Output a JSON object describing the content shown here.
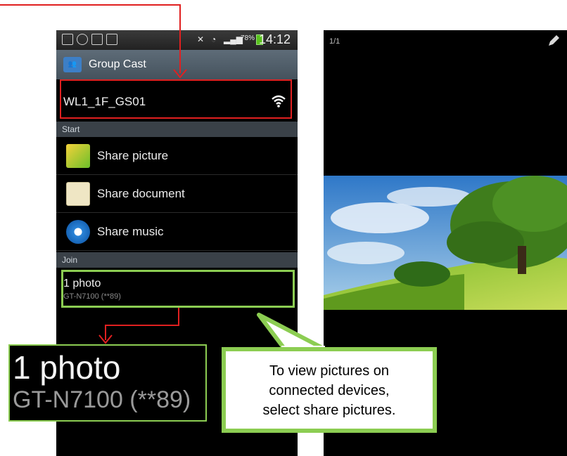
{
  "status_bar": {
    "battery": "78%",
    "time": "14:12"
  },
  "app": {
    "title": "Group Cast",
    "icon": "group-people-icon"
  },
  "network": {
    "name": "WL1_1F_GS01",
    "icon": "wifi-icon"
  },
  "sections": {
    "start_label": "Start",
    "join_label": "Join"
  },
  "menu": [
    {
      "label": "Share picture",
      "icon": "picture-icon"
    },
    {
      "label": "Share document",
      "icon": "document-icon"
    },
    {
      "label": "Share music",
      "icon": "music-icon"
    }
  ],
  "join_item": {
    "title": "1 photo",
    "device": "GT-N7100 (**89)"
  },
  "zoom": {
    "title": "1 photo",
    "device": "GT-N7100 (**89)"
  },
  "callout": {
    "line1": "To view pictures on",
    "line2": "connected devices,",
    "line3": "select share pictures."
  },
  "viewer": {
    "counter": "1/1",
    "edit_icon": "pencil-icon"
  },
  "colors": {
    "annotation_red": "#e02020",
    "annotation_green": "#8ccd52",
    "titlebar": "#4f5c67"
  }
}
